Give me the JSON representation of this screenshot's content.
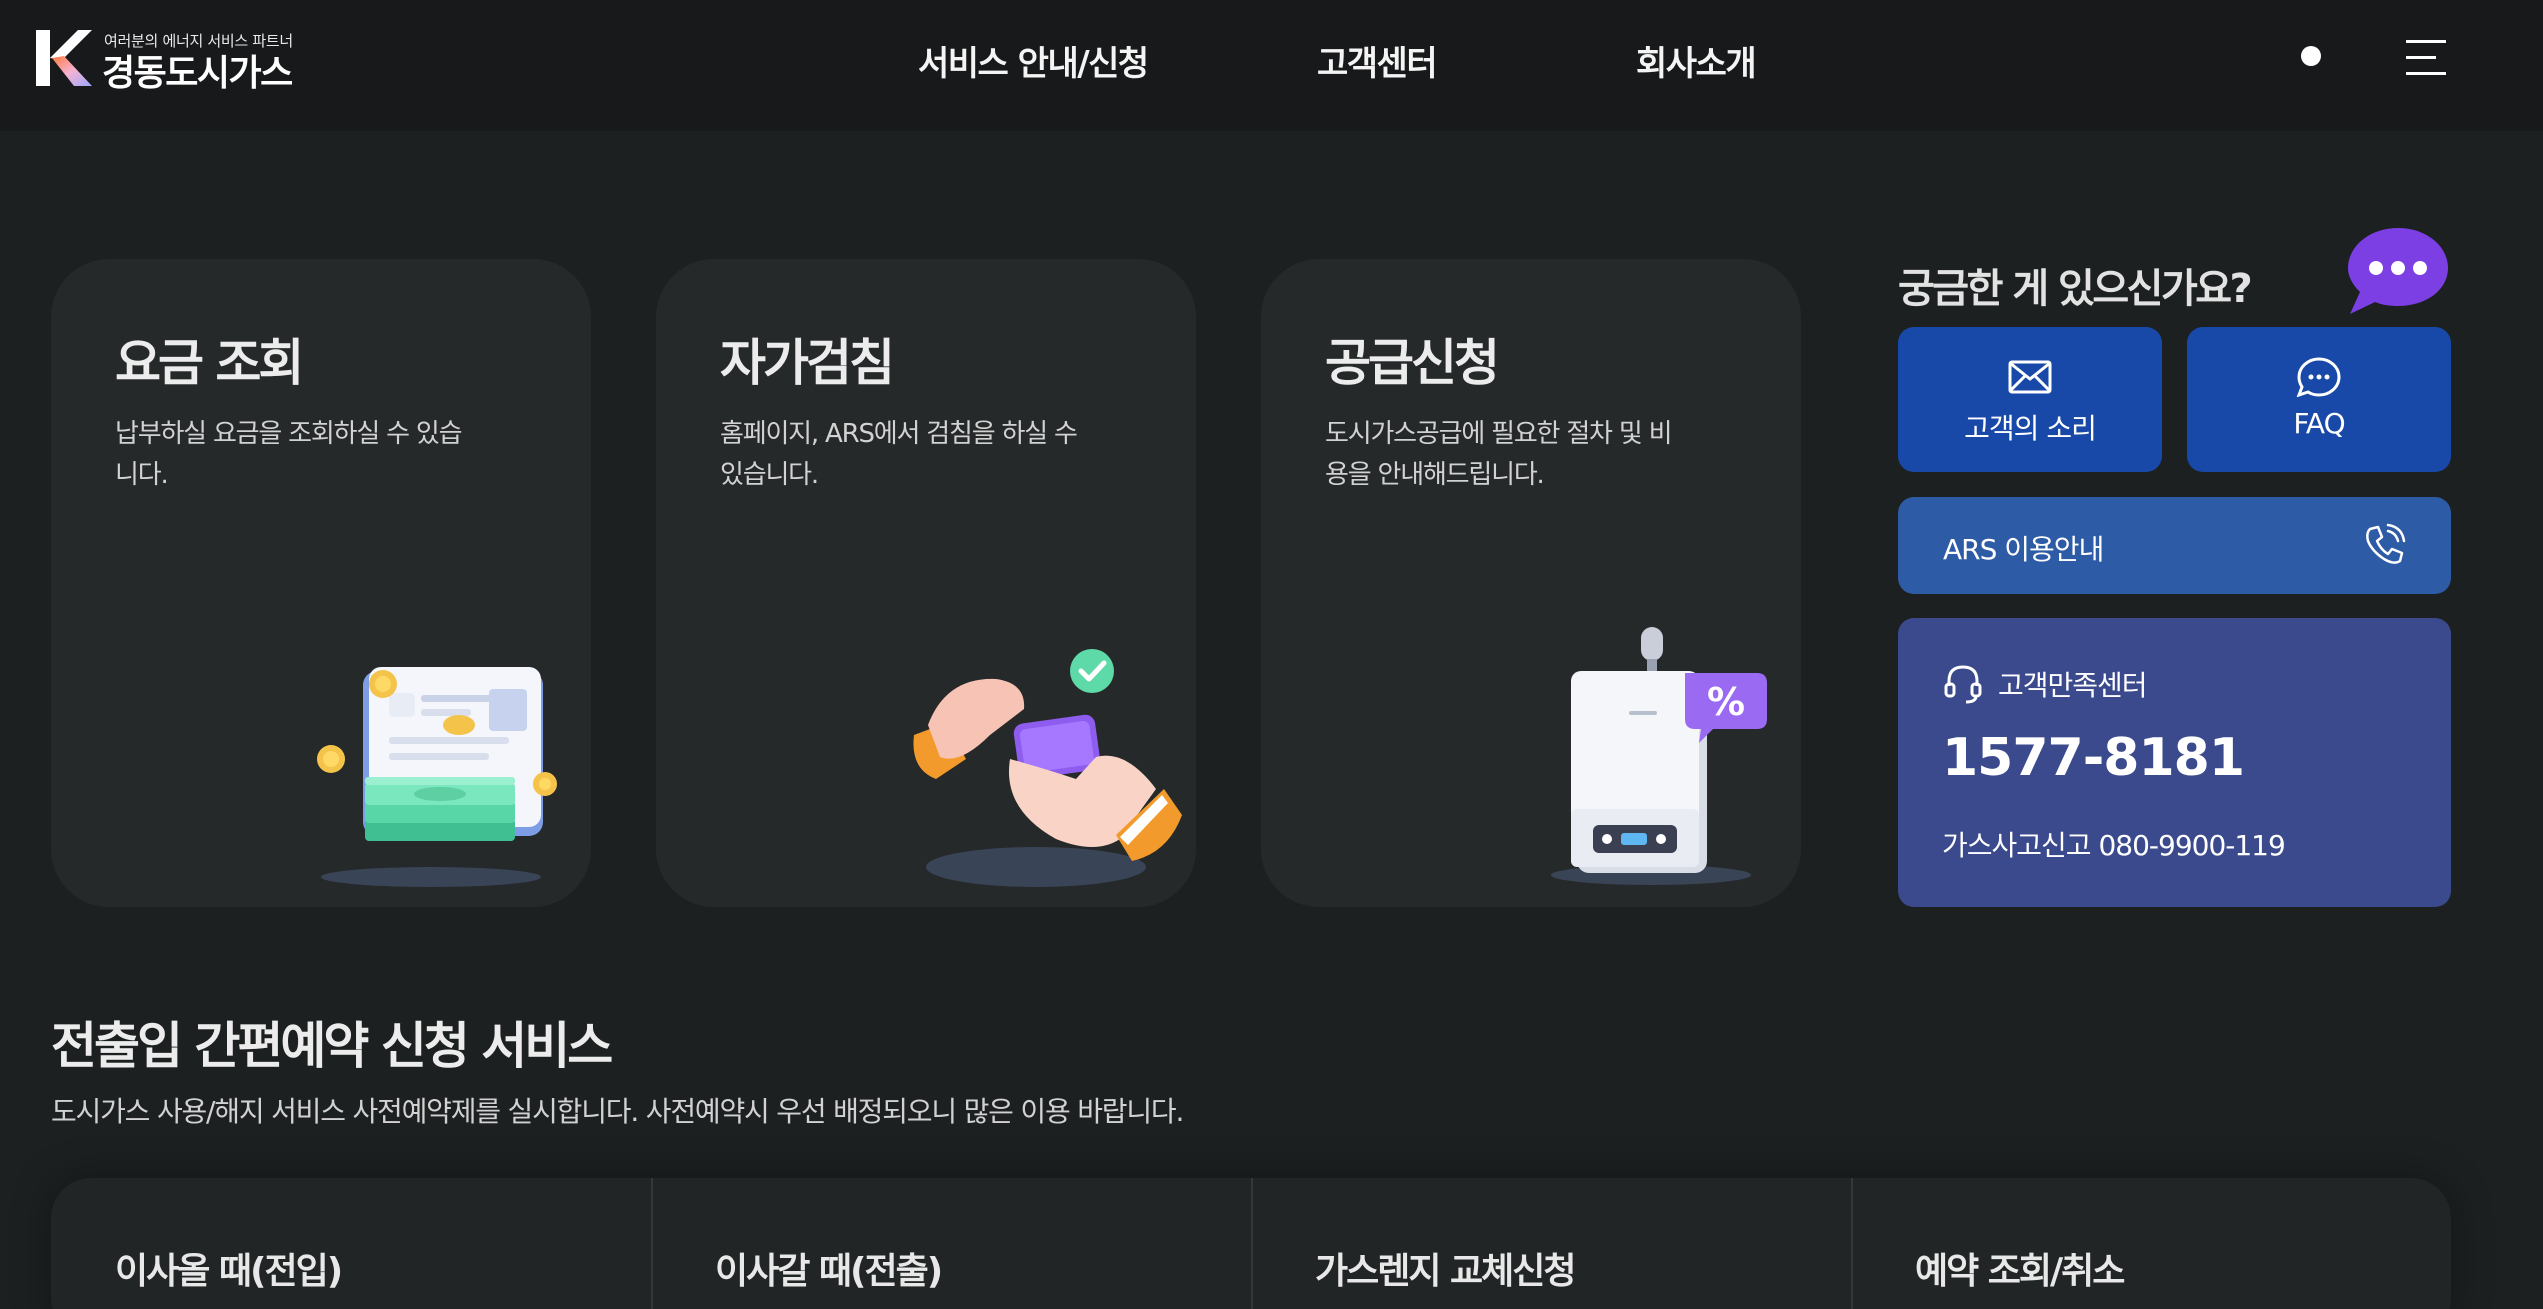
{
  "header": {
    "logo_tagline": "여러분의 에너지 서비스 파트너",
    "logo_name": "경동도시가스",
    "nav": [
      {
        "label": "서비스 안내/신청"
      },
      {
        "label": "고객센터"
      },
      {
        "label": "회사소개"
      }
    ]
  },
  "services": [
    {
      "title": "요금 조회",
      "desc": "납부하실 요금을 조회하실 수 있습니다.",
      "illustration": "bill-money-illustration"
    },
    {
      "title": "자가검침",
      "desc": "홈페이지, ARS에서 검침을 하실 수 있습니다.",
      "illustration": "phone-hand-illustration"
    },
    {
      "title": "공급신청",
      "desc": "도시가스공급에 필요한 절차 및 비용을 안내해드립니다.",
      "illustration": "boiler-illustration"
    }
  ],
  "help": {
    "title": "궁금한 게 있으신가요?",
    "voice_label": "고객의 소리",
    "faq_label": "FAQ",
    "ars_label": "ARS 이용안내",
    "center_label": "고객만족센터",
    "center_phone": "1577-8181",
    "accident_line": "가스사고신고 080-9900-119"
  },
  "reservation": {
    "title": "전출입 간편예약 신청 서비스",
    "desc": "도시가스 사용/해지 서비스 사전예약제를 실시합니다. 사전예약시 우선 배정되오니 많은 이용 바랍니다.",
    "items": [
      {
        "label": "이사올 때(전입)"
      },
      {
        "label": "이사갈 때(전출)"
      },
      {
        "label": "가스렌지 교체신청"
      },
      {
        "label": "예약 조회/취소"
      }
    ]
  },
  "colors": {
    "background": "#1d2021",
    "header": "#17191a",
    "card": "#26292a",
    "button_blue": "#1949a8",
    "ars_blue": "#2e5ba6",
    "center_indigo": "#3b4a8d",
    "chat_purple": "#7b3fe4"
  }
}
